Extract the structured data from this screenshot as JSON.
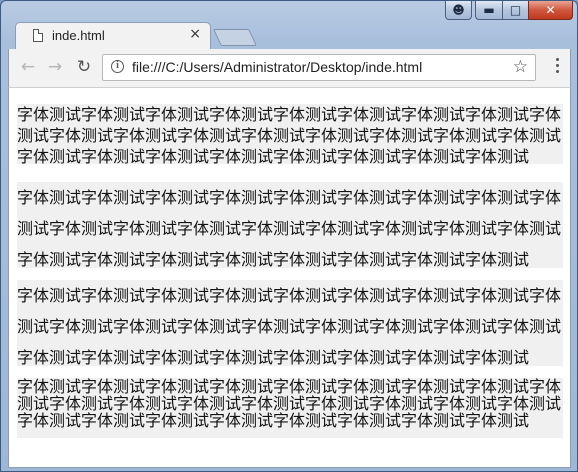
{
  "browser": {
    "tab_title": "inde.html",
    "tab_close": "×",
    "url": "file:///C:/Users/Administrator/Desktop/inde.html",
    "icons": {
      "back": "arrow-left",
      "forward": "arrow-right",
      "reload": "reload",
      "info": "info",
      "star": "bookmark-star",
      "menu": "three-dots-vertical"
    }
  },
  "window_controls": {
    "user": "user-icon",
    "minimize": "minimize",
    "maximize": "maximize",
    "close": "close"
  },
  "content": {
    "paragraphs": [
      "字体测试字体测试字体测试字体测试字体测试字体测试字体测试字体测试字体测试字体测试字体测试字体测试字体测试字体测试字体测试字体测试字体测试字体测试字体测试字体测试字体测试字体测试字体测试字体测试字体测试",
      "字体测试字体测试字体测试字体测试字体测试字体测试字体测试字体测试字体测试字体测试字体测试字体测试字体测试字体测试字体测试字体测试字体测试字体测试字体测试字体测试字体测试字体测试字体测试字体测试字体测试",
      "字体测试字体测试字体测试字体测试字体测试字体测试字体测试字体测试字体测试字体测试字体测试字体测试字体测试字体测试字体测试字体测试字体测试字体测试字体测试字体测试字体测试字体测试字体测试字体测试字体测试",
      "字体测试字体测试字体测试字体测试字体测试字体测试字体测试字体测试字体测试字体测试字体测试字体测试字体测试字体测试字体测试字体测试字体测试字体测试字体测试字体测试字体测试字体测试字体测试字体测试字体测试"
    ]
  }
}
